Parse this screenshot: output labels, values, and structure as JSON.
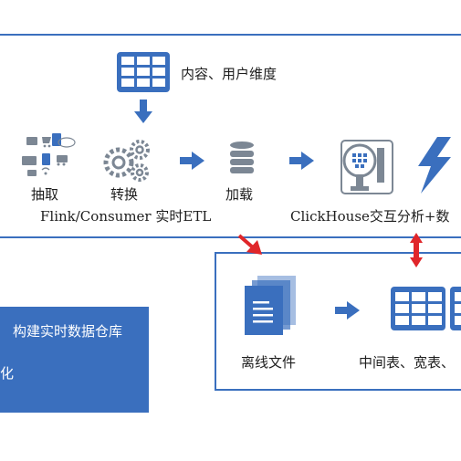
{
  "top_panel": {
    "source_label": "内容、用户维度",
    "steps": [
      "抽取",
      "转换",
      "加载"
    ],
    "etl_caption": "Flink/Consumer 实时ETL",
    "analysis_caption": "ClickHouse交互分析+数"
  },
  "bottom_panel": {
    "offline_label": "离线文件",
    "tables_label": "中间表、宽表、"
  },
  "side_box": {
    "line1": "构建实时数据仓库",
    "line2": "化"
  },
  "colors": {
    "accent": "#3a6fbe",
    "arrow_red": "#e0262a",
    "icon_gray": "#7c8794"
  }
}
